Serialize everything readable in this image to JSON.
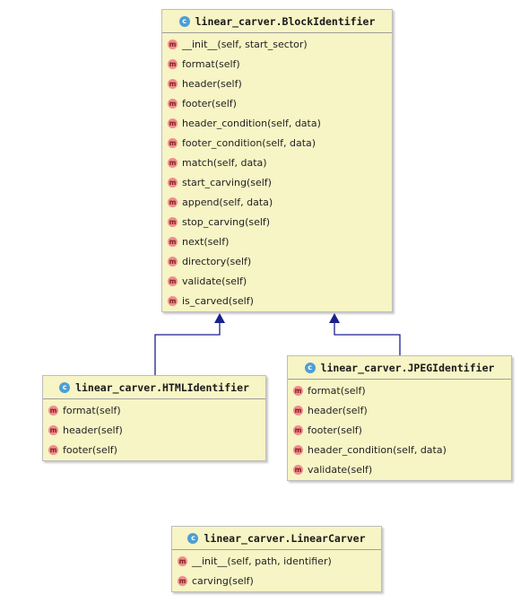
{
  "classes": {
    "block": {
      "name": "linear_carver.BlockIdentifier",
      "kind_badge": "c",
      "methods": [
        "__init__(self, start_sector)",
        "format(self)",
        "header(self)",
        "footer(self)",
        "header_condition(self, data)",
        "footer_condition(self, data)",
        "match(self, data)",
        "start_carving(self)",
        "append(self, data)",
        "stop_carving(self)",
        "next(self)",
        "directory(self)",
        "validate(self)",
        "is_carved(self)"
      ]
    },
    "html": {
      "name": "linear_carver.HTMLIdentifier",
      "kind_badge": "c",
      "methods": [
        "format(self)",
        "header(self)",
        "footer(self)"
      ]
    },
    "jpeg": {
      "name": "linear_carver.JPEGIdentifier",
      "kind_badge": "c",
      "methods": [
        "format(self)",
        "header(self)",
        "footer(self)",
        "header_condition(self, data)",
        "validate(self)"
      ]
    },
    "linear": {
      "name": "linear_carver.LinearCarver",
      "kind_badge": "c",
      "methods": [
        "__init__(self, path, identifier)",
        "carving(self)"
      ]
    }
  },
  "method_badge": "m",
  "colors": {
    "class_fill": "#f7f4c5",
    "class_badge": "#4d9fd4",
    "method_badge": "#f28c8c",
    "edge": "#1a1f8f"
  },
  "relations": [
    {
      "from": "html",
      "to": "block",
      "type": "inheritance"
    },
    {
      "from": "jpeg",
      "to": "block",
      "type": "inheritance"
    }
  ]
}
